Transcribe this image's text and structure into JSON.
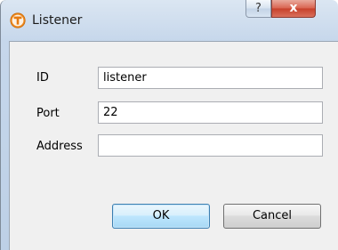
{
  "window": {
    "title": "Listener",
    "help_label": "?",
    "close_label": "x"
  },
  "form": {
    "fields": [
      {
        "label": "ID",
        "value": "listener"
      },
      {
        "label": "Port",
        "value": "22"
      },
      {
        "label": "Address",
        "value": ""
      }
    ]
  },
  "buttons": {
    "ok_label": "OK",
    "cancel_label": "Cancel"
  },
  "colors": {
    "app_icon": "#f08a1c",
    "close_button": "#c7402a",
    "default_button_border": "#3c7fb1"
  },
  "icons": {
    "app": "app-logo-icon",
    "help": "help-icon",
    "close": "close-icon"
  }
}
